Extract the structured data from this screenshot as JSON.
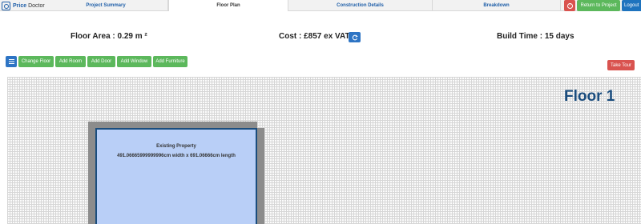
{
  "brand": {
    "name_bold": "Price",
    "name_rest": "Doctor"
  },
  "nav": {
    "tabs": [
      {
        "label": "Project Summary"
      },
      {
        "label": "Floor Plan"
      },
      {
        "label": "Construction Details"
      },
      {
        "label": "Breakdown"
      }
    ],
    "help_icon": "question-circle-icon",
    "return_label": "Return to Project",
    "logout_label": "Logout"
  },
  "summary": {
    "floor_area": "Floor Area : 0.29 m ²",
    "cost": "Cost : £857 ex VAT",
    "build_time": "Build Time : 15 days",
    "refresh_icon": "refresh-icon"
  },
  "toolbar": {
    "menu_icon": "hamburger-menu-icon",
    "change_floor": "Change Floor",
    "add_room": "Add Room",
    "add_door": "Add Door",
    "add_window": "Add Window",
    "add_furniture": "Add Furniture",
    "take_tour": "Take Tour"
  },
  "canvas": {
    "floor_label": "Floor 1",
    "room": {
      "title": "Existing Property",
      "dimensions": "491.06665999999996cm width x 691.06666cm length"
    }
  },
  "colors": {
    "primary_blue": "#1e73be",
    "success_green": "#5cb85c",
    "danger_red": "#d9534f",
    "room_fill": "#b9cff7",
    "wall_grey": "#8c8c8c"
  }
}
